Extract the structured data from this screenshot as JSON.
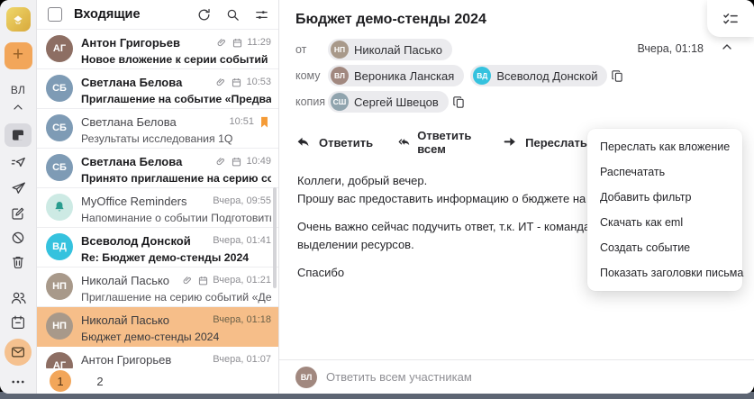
{
  "colors": {
    "accent_orange": "#F2A65A",
    "selected_row": "#F6BE89",
    "flag_orange": "#F59B36",
    "avatar_vd_cyan": "#35C2DE",
    "reminders_teal": "#2A9D8F"
  },
  "sidebar": {
    "user_initials": "ВЛ",
    "plus_glyph": "+"
  },
  "mail_list": {
    "title": "Входящие",
    "items": [
      {
        "name": "Антон Григорьев",
        "time": "11:29",
        "subject": "Новое вложение к серии событий «Аналити…",
        "unread": true,
        "attachment": true,
        "event": true,
        "avatar": {
          "initials": "АГ",
          "bg": "#8d6e63"
        }
      },
      {
        "name": "Светлана Белова",
        "time": "10:53",
        "subject": "Приглашение на событие «Предварительно…",
        "unread": true,
        "attachment": true,
        "event": true,
        "avatar": {
          "initials": "СБ",
          "bg": "#7e9bb5"
        }
      },
      {
        "name": "Светлана Белова",
        "time": "10:51",
        "subject": "Результаты исследования 1Q",
        "unread": false,
        "flag": true,
        "avatar": {
          "initials": "СБ",
          "bg": "#7e9bb5"
        }
      },
      {
        "name": "Светлана Белова",
        "time": "10:49",
        "subject": "Принято приглашение на серию событий «…",
        "unread": true,
        "attachment": true,
        "event": true,
        "avatar": {
          "initials": "СБ",
          "bg": "#7e9bb5"
        }
      },
      {
        "name": "MyOffice Reminders",
        "time": "Вчера, 09:55",
        "subject": "Напоминание о событии Подготовить отчет…",
        "unread": false,
        "bell": true,
        "avatar": {
          "initials": "",
          "bg": "#cdeae4"
        }
      },
      {
        "name": "Всеволод Донской",
        "time": "Вчера, 01:41",
        "subject": "Re: Бюджет демо-стенды 2024",
        "unread": true,
        "avatar": {
          "initials": "ВД",
          "bg": "#35C2DE"
        }
      },
      {
        "name": "Николай Пасько",
        "time": "Вчера, 01:21",
        "subject": "Приглашение на серию событий «Демо стен…",
        "unread": false,
        "attachment": true,
        "event": true,
        "avatar": {
          "initials": "НП",
          "bg": "#a8998a"
        }
      },
      {
        "name": "Николай Пасько",
        "time": "Вчера, 01:18",
        "subject": "Бюджет демо-стенды 2024",
        "unread": false,
        "selected": true,
        "avatar": {
          "initials": "НП",
          "bg": "#a8998a"
        }
      },
      {
        "name": "Антон Григорьев",
        "time": "Вчера, 01:07",
        "subject": "",
        "unread": false,
        "avatar": {
          "initials": "АГ",
          "bg": "#8d6e63"
        }
      }
    ],
    "pagination": [
      "1",
      "2"
    ]
  },
  "message": {
    "subject": "Бюджет демо-стенды 2024",
    "date": "Вчера, 01:18",
    "from_label": "от",
    "to_label": "кому",
    "cc_label": "копия",
    "from": [
      {
        "name": "Николай Пасько",
        "initials": "НП",
        "bg": "#a8998a"
      }
    ],
    "to": [
      {
        "name": "Вероника Ланская",
        "initials": "ВЛ",
        "bg": "#a1887f"
      },
      {
        "name": "Всеволод Донской",
        "initials": "ВД",
        "bg": "#35C2DE"
      }
    ],
    "cc": [
      {
        "name": "Сергей Швецов",
        "initials": "СШ",
        "bg": "#90a4ae"
      }
    ],
    "toolbar": {
      "reply": "Ответить",
      "reply_all": "Ответить всем",
      "forward": "Переслать"
    },
    "body_lines": [
      "Коллеги, добрый вечер.",
      "Прошу вас предоставить информацию о бюджете на наши демонстраци",
      "",
      "Очень важно сейчас подучить ответ, т.к. ИТ - команда Всеволода, уже",
      "выделении ресурсов.",
      "",
      "Спасибо"
    ],
    "reply_bar": {
      "placeholder": "Ответить всем участникам",
      "user_initials": "ВЛ"
    }
  },
  "context_menu": {
    "items": [
      "Переслать как вложение",
      "Распечатать",
      "Добавить фильтр",
      "Скачать как eml",
      "Создать событие",
      "Показать заголовки письма"
    ]
  }
}
